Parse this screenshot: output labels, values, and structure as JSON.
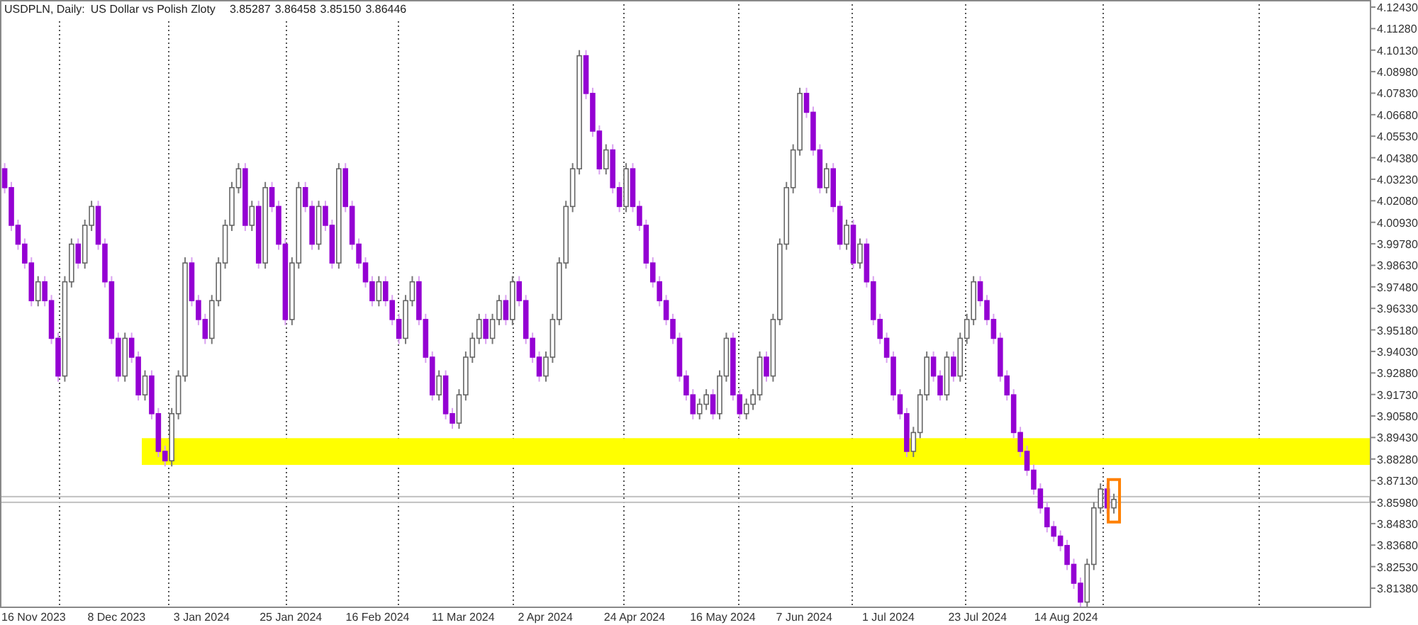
{
  "header": {
    "symbol": "USDPLN, Daily:",
    "description": "US Dollar vs Polish Zloty",
    "prices": [
      "3.85287",
      "3.86458",
      "3.85150",
      "3.86446"
    ]
  },
  "chart": {
    "price_labels": [
      "4.12430",
      "4.11280",
      "4.10130",
      "4.08980",
      "4.07830",
      "4.06680",
      "4.05530",
      "4.04380",
      "4.03230",
      "4.02080",
      "4.00930",
      "3.99780",
      "3.98630",
      "3.97480",
      "3.96330",
      "3.95180",
      "3.94030",
      "3.92880",
      "3.91730",
      "3.90580",
      "3.89430",
      "3.88280",
      "3.87130",
      "3.85980",
      "3.84830",
      "3.83680",
      "3.82530",
      "3.81380"
    ],
    "date_labels": [
      "16 Nov 2023",
      "8 Dec 2023",
      "3 Jan 2024",
      "25 Jan 2024",
      "16 Feb 2024",
      "11 Mar 2024",
      "2 Apr 2024",
      "24 Apr 2024",
      "16 May 2024",
      "7 Jun 2024",
      "1 Jul 2024",
      "23 Jul 2024",
      "14 Aug 2024"
    ]
  }
}
